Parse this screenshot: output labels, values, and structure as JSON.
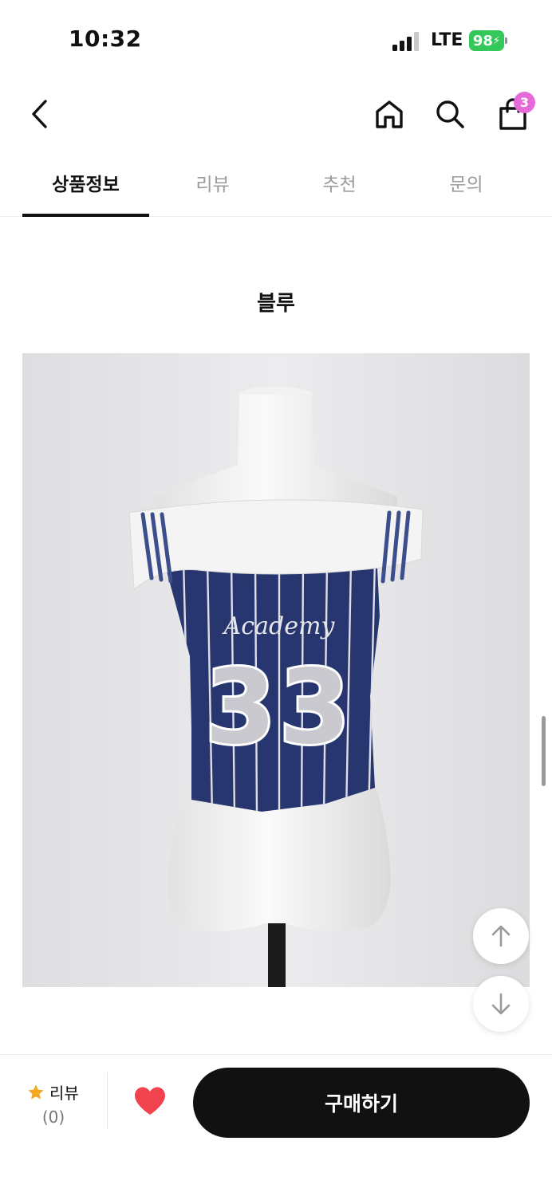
{
  "status_bar": {
    "time": "10:32",
    "network": "LTE",
    "battery": "98"
  },
  "header": {
    "back_icon": "chevron-left-icon",
    "home_icon": "home-icon",
    "search_icon": "search-icon",
    "cart_icon": "shopping-bag-icon",
    "cart_count": "3"
  },
  "tabs": [
    {
      "label": "상품정보",
      "active": true
    },
    {
      "label": "리뷰",
      "active": false
    },
    {
      "label": "추천",
      "active": false
    },
    {
      "label": "문의",
      "active": false
    }
  ],
  "content": {
    "section_title": "블루",
    "product_image": {
      "shirt_text": "Academy",
      "shirt_number": "33"
    }
  },
  "floating": {
    "up_icon": "arrow-up-icon",
    "down_icon": "arrow-down-icon"
  },
  "bottom_bar": {
    "review_label": "리뷰",
    "review_count": "(0)",
    "like_icon": "heart-icon",
    "buy_label": "구매하기"
  },
  "colors": {
    "accent_badge": "#e66ad8",
    "heart": "#f0434e",
    "star": "#f5a623",
    "battery": "#34c759",
    "buy_button": "#111111",
    "jersey_navy": "#27366f"
  }
}
